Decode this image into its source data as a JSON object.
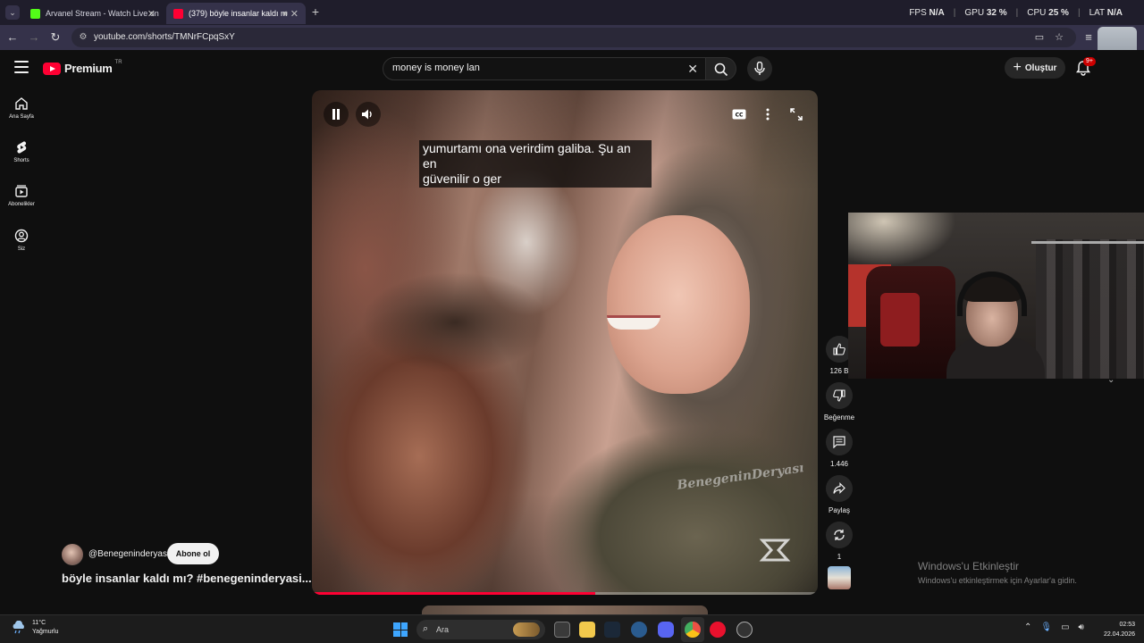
{
  "browser": {
    "tabs": [
      {
        "label": "Arvanel Stream - Watch Live on",
        "favicon": "kick-icon",
        "color": "#53fc18"
      },
      {
        "label": "(379) böyle insanlar kaldı m",
        "favicon": "youtube-icon",
        "color": "#ff0033",
        "active": true
      }
    ],
    "url": "youtube.com/shorts/TMNrFCpqSxY"
  },
  "perf_overlay": {
    "fps_label": "FPS",
    "fps_value": "N/A",
    "gpu_label": "GPU",
    "gpu_value": "32 %",
    "cpu_label": "CPU",
    "cpu_value": "25 %",
    "lat_label": "LAT",
    "lat_value": "N/A"
  },
  "youtube": {
    "logo_text": "Premium",
    "country_code": "TR",
    "search": {
      "value": "money is money lan",
      "placeholder": "Ara"
    },
    "create_label": "Oluştur",
    "notification_count": "9+",
    "sidebar": [
      {
        "label": "Ana Sayfa",
        "icon": "home-icon"
      },
      {
        "label": "Shorts",
        "icon": "shorts-icon"
      },
      {
        "label": "Abonelikler",
        "icon": "subscriptions-icon"
      },
      {
        "label": "Siz",
        "icon": "account-icon"
      }
    ],
    "video": {
      "subtitle_line1": "yumurtamı ona verirdim galiba. Şu an en",
      "subtitle_line2": "güvenilir o ger",
      "watermark": "BenegeninDeryası",
      "progress": 0.56
    },
    "actions": {
      "likes": "126 B",
      "dislike_label": "Beğenme",
      "comments": "1.446",
      "share_label": "Paylaş",
      "remix_count": "1"
    },
    "channel": {
      "handle": "@Benegeninderyasi",
      "subscribe_label": "Abone ol"
    },
    "title": "böyle insanlar kaldı mı? #benegeninderyasi..."
  },
  "windows_activation": {
    "title": "Windows'u Etkinleştir",
    "subtitle": "Windows'u etkinleştirmek için Ayarlar'a gidin."
  },
  "taskbar": {
    "weather_temp": "11°C",
    "weather_desc": "Yağmurlu",
    "search_placeholder": "Ara",
    "time": "02:53",
    "date": "22.04.2026"
  }
}
